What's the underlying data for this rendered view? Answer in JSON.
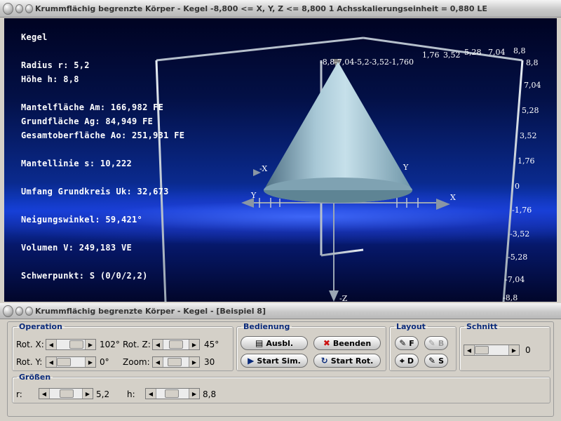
{
  "main_window": {
    "title": "Krummflächig begrenzte Körper - Kegel    -8,800 <= X, Y, Z <= 8,800    1 Achsskalierungseinheit = 0,880 LE"
  },
  "info": {
    "shape": "Kegel",
    "radius": "Radius r: 5,2",
    "height": "Höhe h: 8,8",
    "mantelflaeche": "Mantelfläche Am: 166,982 FE",
    "grundflaeche": "Grundfläche Ag: 84,949 FE",
    "gesamtoberflaeche": "Gesamtoberfläche Ao: 251,931 FE",
    "mantellinie": "Mantellinie s: 10,222",
    "umfang": "Umfang Grundkreis Uk: 32,673",
    "neigungswinkel": "Neigungswinkel: 59,421°",
    "volumen": "Volumen V: 249,183 VE",
    "schwerpunkt": "Schwerpunkt: S (0/0/2,2)"
  },
  "axes": {
    "z_ticks": [
      "8,8",
      "7,04",
      "5,28",
      "3,52",
      "1,76",
      "0",
      "-1,76",
      "-3,52",
      "-5,28",
      "-7,04",
      "-8,8"
    ],
    "top_ticks": [
      "1,76",
      "3,52",
      "5,28",
      "7,04",
      "8,8"
    ],
    "top_left_ticks": "-8,8-7,04-5,2-3,52-1,760",
    "x_label": "X",
    "y_label": "Y",
    "neg_x_label": "-X",
    "z_label": "Z",
    "neg_z_label": "-Z"
  },
  "control_window": {
    "title": "Krummflächig begrenzte Körper - Kegel - [Beispiel 8]"
  },
  "operation": {
    "legend": "Operation",
    "rot_x_label": "Rot. X:",
    "rot_x_value": "102°",
    "rot_y_label": "Rot. Y:",
    "rot_y_value": "0°",
    "rot_z_label": "Rot. Z:",
    "rot_z_value": "45°",
    "zoom_label": "Zoom:",
    "zoom_value": "30"
  },
  "bedienung": {
    "legend": "Bedienung",
    "ausbl_label": "Ausbl.",
    "beenden_label": "Beenden",
    "start_sim_label": "Start Sim.",
    "start_rot_label": "Start Rot."
  },
  "layout": {
    "legend": "Layout",
    "f_label": "F",
    "b_label": "B",
    "d_label": "D",
    "s_label": "S"
  },
  "schnitt": {
    "legend": "Schnitt",
    "value": "0"
  },
  "groessen": {
    "legend": "Größen",
    "r_label": "r:",
    "r_value": "5,2",
    "h_label": "h:",
    "h_value": "8,8"
  },
  "colors": {
    "accent_blue": "#0a2a7a",
    "beenden_x": "#cc1111",
    "background_gray": "#d4d0c8"
  }
}
